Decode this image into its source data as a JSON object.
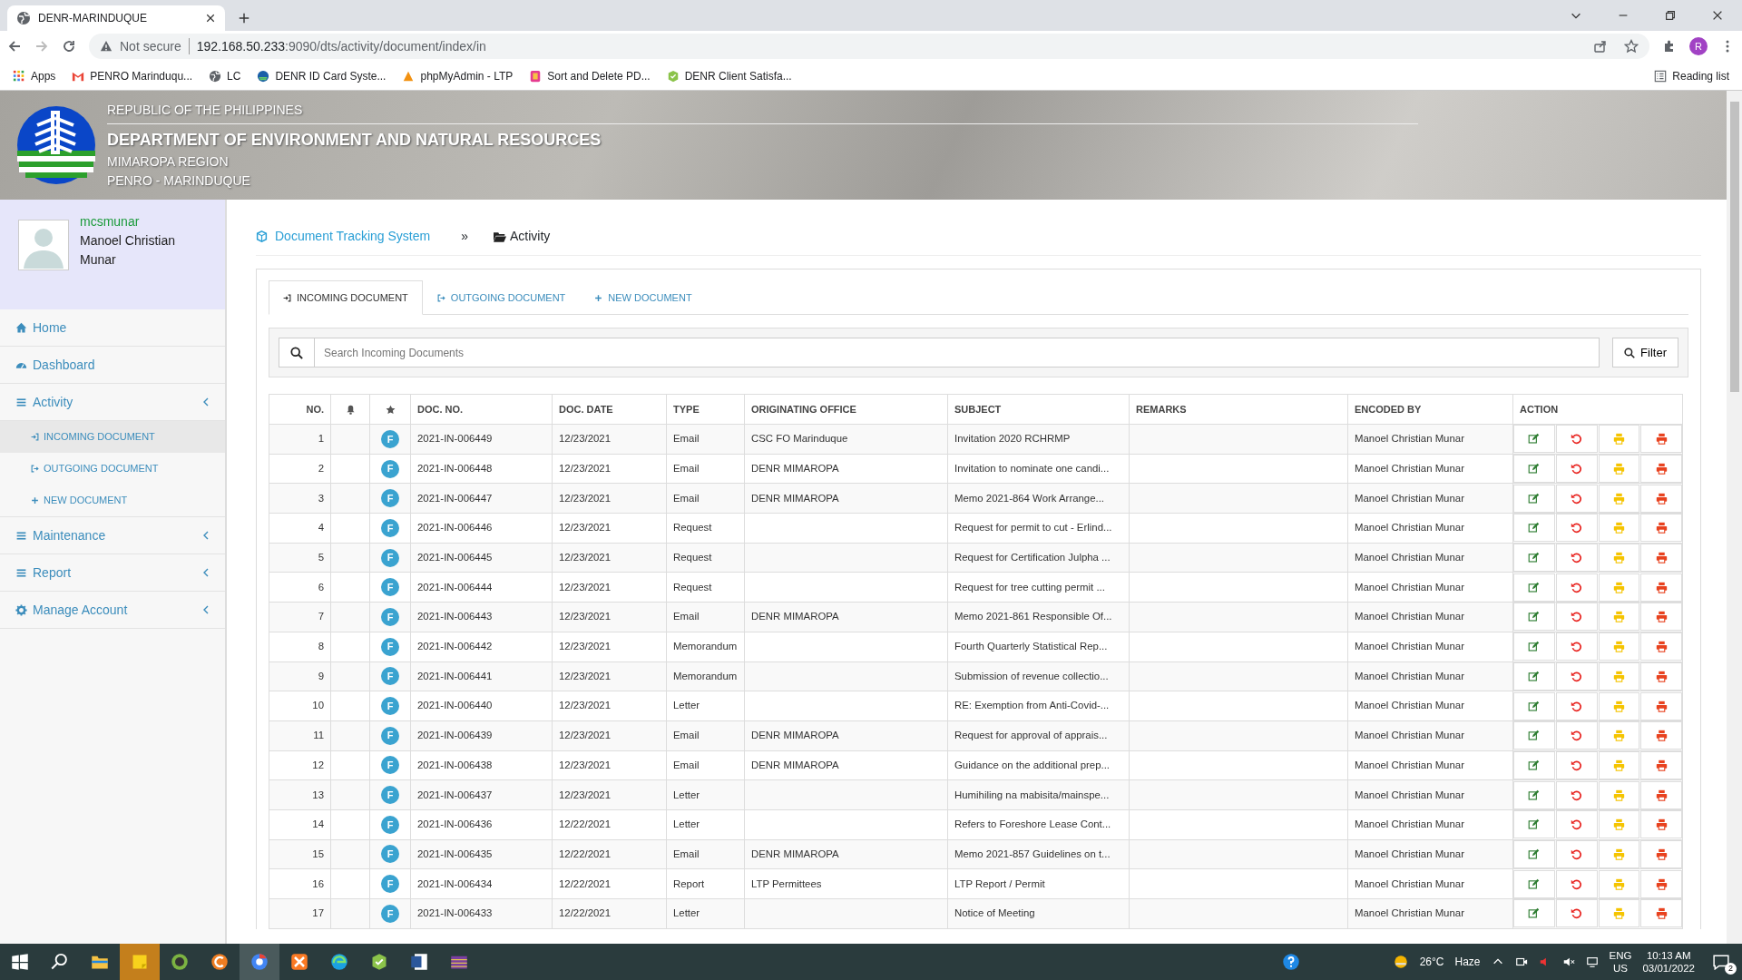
{
  "browser": {
    "tab_title": "DENR-MARINDUQUE",
    "security": "Not secure",
    "url_host": "192.168.50.233",
    "url_path": ":9090/dts/activity/document/index/in",
    "profile_initial": "R",
    "bookmarks": [
      {
        "label": "Apps"
      },
      {
        "label": "PENRO Marinduqu..."
      },
      {
        "label": "LC"
      },
      {
        "label": "DENR ID Card Syste..."
      },
      {
        "label": "phpMyAdmin - LTP"
      },
      {
        "label": "Sort and Delete PD..."
      },
      {
        "label": "DENR Client Satisfa..."
      }
    ],
    "reading_list": "Reading list"
  },
  "header": {
    "line1": "REPUBLIC OF THE PHILIPPINES",
    "line2": "DEPARTMENT OF ENVIRONMENT AND NATURAL RESOURCES",
    "line3": "MIMAROPA REGION",
    "line4": "PENRO - MARINDUQUE"
  },
  "user": {
    "username": "mcsmunar",
    "full_name": "Manoel Christian Munar"
  },
  "sidebar": {
    "items": [
      {
        "label": "Home",
        "caret": false
      },
      {
        "label": "Dashboard",
        "caret": false
      },
      {
        "label": "Activity",
        "caret": true,
        "children": [
          {
            "label": "INCOMING DOCUMENT",
            "selected": true
          },
          {
            "label": "OUTGOING DOCUMENT",
            "selected": false
          },
          {
            "label": "NEW DOCUMENT",
            "selected": false
          }
        ]
      },
      {
        "label": "Maintenance",
        "caret": true
      },
      {
        "label": "Report",
        "caret": true
      },
      {
        "label": "Manage Account",
        "caret": true
      }
    ]
  },
  "breadcrumb": {
    "root": "Document Tracking System",
    "separator": "»",
    "current": "Activity"
  },
  "tabs": [
    {
      "label": "INCOMING DOCUMENT",
      "selected": true
    },
    {
      "label": "OUTGOING DOCUMENT",
      "selected": false
    },
    {
      "label": "NEW DOCUMENT",
      "selected": false
    }
  ],
  "search": {
    "placeholder": "Search Incoming Documents"
  },
  "filter_button": "Filter",
  "table": {
    "columns": [
      "NO.",
      "DOC. NO.",
      "DOC. DATE",
      "TYPE",
      "ORIGINATING OFFICE",
      "SUBJECT",
      "REMARKS",
      "ENCODED BY",
      "ACTION"
    ],
    "rows": [
      {
        "no": "1",
        "flag": "F",
        "doc_no": "2021-IN-006449",
        "date": "12/23/2021",
        "type": "Email",
        "office": "CSC FO Marinduque",
        "subject": "Invitation 2020 RCHRMP",
        "encoded_by": "Manoel Christian Munar"
      },
      {
        "no": "2",
        "flag": "F",
        "doc_no": "2021-IN-006448",
        "date": "12/23/2021",
        "type": "Email",
        "office": "DENR MIMAROPA",
        "subject": "Invitation to nominate one candi...",
        "encoded_by": "Manoel Christian Munar"
      },
      {
        "no": "3",
        "flag": "F",
        "doc_no": "2021-IN-006447",
        "date": "12/23/2021",
        "type": "Email",
        "office": "DENR MIMAROPA",
        "subject": "Memo 2021-864 Work Arrange...",
        "encoded_by": "Manoel Christian Munar"
      },
      {
        "no": "4",
        "flag": "F",
        "doc_no": "2021-IN-006446",
        "date": "12/23/2021",
        "type": "Request",
        "subject": "Request for permit to cut - Erlind...",
        "encoded_by": "Manoel Christian Munar"
      },
      {
        "no": "5",
        "flag": "F",
        "doc_no": "2021-IN-006445",
        "date": "12/23/2021",
        "type": "Request",
        "subject": "Request for Certification Julpha ...",
        "encoded_by": "Manoel Christian Munar"
      },
      {
        "no": "6",
        "flag": "F",
        "doc_no": "2021-IN-006444",
        "date": "12/23/2021",
        "type": "Request",
        "subject": "Request for tree cutting permit ...",
        "encoded_by": "Manoel Christian Munar"
      },
      {
        "no": "7",
        "flag": "F",
        "doc_no": "2021-IN-006443",
        "date": "12/23/2021",
        "type": "Email",
        "office": "DENR MIMAROPA",
        "subject": "Memo 2021-861 Responsible Of...",
        "encoded_by": "Manoel Christian Munar"
      },
      {
        "no": "8",
        "flag": "F",
        "doc_no": "2021-IN-006442",
        "date": "12/23/2021",
        "type": "Memorandum",
        "subject": "Fourth Quarterly Statistical Rep...",
        "encoded_by": "Manoel Christian Munar"
      },
      {
        "no": "9",
        "flag": "F",
        "doc_no": "2021-IN-006441",
        "date": "12/23/2021",
        "type": "Memorandum",
        "subject": "Submission of revenue collectio...",
        "encoded_by": "Manoel Christian Munar"
      },
      {
        "no": "10",
        "flag": "F",
        "doc_no": "2021-IN-006440",
        "date": "12/23/2021",
        "type": "Letter",
        "subject": "RE: Exemption from Anti-Covid-...",
        "encoded_by": "Manoel Christian Munar"
      },
      {
        "no": "11",
        "flag": "F",
        "doc_no": "2021-IN-006439",
        "date": "12/23/2021",
        "type": "Email",
        "office": "DENR MIMAROPA",
        "subject": "Request for approval of apprais...",
        "encoded_by": "Manoel Christian Munar"
      },
      {
        "no": "12",
        "flag": "F",
        "doc_no": "2021-IN-006438",
        "date": "12/23/2021",
        "type": "Email",
        "office": "DENR MIMAROPA",
        "subject": "Guidance on the additional prep...",
        "encoded_by": "Manoel Christian Munar"
      },
      {
        "no": "13",
        "flag": "F",
        "doc_no": "2021-IN-006437",
        "date": "12/23/2021",
        "type": "Letter",
        "subject": "Humihiling na mabisita/mainspe...",
        "encoded_by": "Manoel Christian Munar"
      },
      {
        "no": "14",
        "flag": "F",
        "doc_no": "2021-IN-006436",
        "date": "12/22/2021",
        "type": "Letter",
        "subject": "Refers to Foreshore Lease Cont...",
        "encoded_by": "Manoel Christian Munar"
      },
      {
        "no": "15",
        "flag": "F",
        "doc_no": "2021-IN-006435",
        "date": "12/22/2021",
        "type": "Email",
        "office": "DENR MIMAROPA",
        "subject": "Memo 2021-857 Guidelines on t...",
        "encoded_by": "Manoel Christian Munar"
      },
      {
        "no": "16",
        "flag": "F",
        "doc_no": "2021-IN-006434",
        "date": "12/22/2021",
        "type": "Report",
        "office": "LTP Permittees",
        "subject": "LTP Report / Permit",
        "encoded_by": "Manoel Christian Munar"
      },
      {
        "no": "17",
        "flag": "F",
        "doc_no": "2021-IN-006433",
        "date": "12/22/2021",
        "type": "Letter",
        "subject": "Notice of Meeting",
        "encoded_by": "Manoel Christian Munar"
      }
    ]
  },
  "taskbar": {
    "weather": "26°C",
    "condition": "Haze",
    "language": "ENG",
    "region": "US",
    "time": "10:13 AM",
    "date": "03/01/2022",
    "notifications": "2"
  }
}
